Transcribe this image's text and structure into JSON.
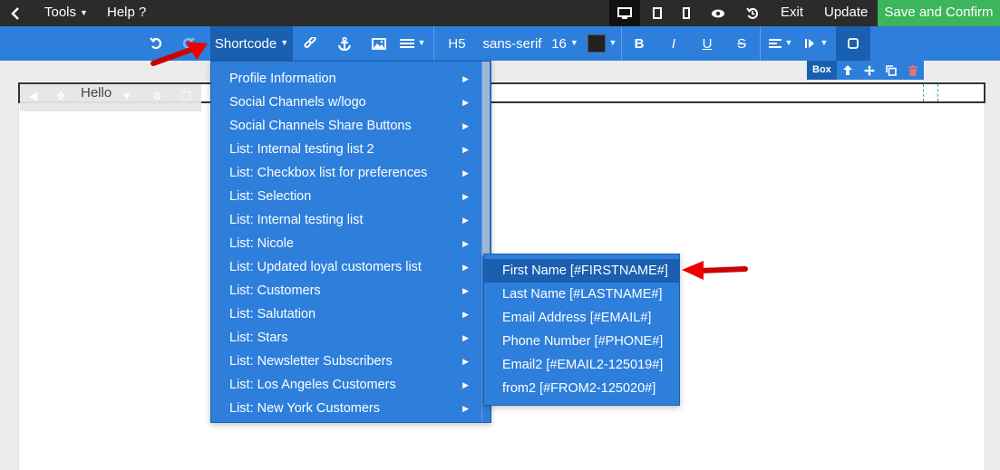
{
  "topbar": {
    "back_icon": "chevron-left-icon",
    "tools_label": "Tools",
    "help_label": "Help ?",
    "devices": [
      "desktop-icon",
      "tablet-icon",
      "mobile-icon"
    ],
    "preview_icon": "eye-icon",
    "history_icon": "history-icon",
    "exit_label": "Exit",
    "update_label": "Update",
    "save_label": "Save and Confirm"
  },
  "toolbar": {
    "undo_icon": "undo-icon",
    "redo_icon": "redo-icon",
    "shortcode_label": "Shortcode",
    "link_icon": "link-icon",
    "anchor_icon": "anchor-icon",
    "image_icon": "image-icon",
    "list_icon": "list-icon",
    "heading_label": "H5",
    "font_label": "sans-serif",
    "size_label": "16",
    "color": "#222222",
    "bold_label": "B",
    "italic_label": "I",
    "underline_label": "U",
    "strike_label": "S",
    "align_icon": "align-left-icon",
    "direction_icon": "text-direction-icon",
    "box_icon": "square-icon"
  },
  "box_label": {
    "label": "Box",
    "up_icon": "arrow-up-icon",
    "move_icon": "move-icon",
    "copy_icon": "copy-icon",
    "delete_icon": "trash-icon"
  },
  "canvas": {
    "hello_text": "Hello"
  },
  "shortcode_menu": {
    "items": [
      "Profile Information",
      "Social Channels w/logo",
      "Social Channels Share Buttons",
      "List: Internal testing list 2",
      "List: Checkbox list for preferences",
      "List: Selection",
      "List: Internal testing list",
      "List: Nicole",
      "List: Updated loyal customers list",
      "List: Customers",
      "List: Salutation",
      "List: Stars",
      "List: Newsletter Subscribers",
      "List: Los Angeles Customers",
      "List: New York Customers"
    ]
  },
  "submenu": {
    "items": [
      "First Name [#FIRSTNAME#]",
      "Last Name [#LASTNAME#]",
      "Email Address [#EMAIL#]",
      "Phone Number [#PHONE#]",
      "Email2 [#EMAIL2-125019#]",
      "from2 [#FROM2-125020#]"
    ]
  }
}
